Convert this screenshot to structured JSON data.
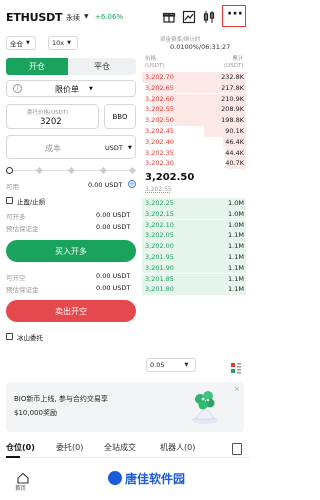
{
  "header": {
    "symbol": "ETHUSDT",
    "contract_type": "永续",
    "change": "+6.06%",
    "icons": [
      "gift-icon",
      "chart-icon",
      "candlestick-icon",
      "more-icon"
    ]
  },
  "controls": {
    "margin_mode": "全仓",
    "leverage": "10x"
  },
  "funding": {
    "label": "资金费率/倒计时",
    "value": "0.0100%/06:31:27"
  },
  "trade_tabs": {
    "open": "开仓",
    "close": "平仓"
  },
  "order_type": "限价单",
  "price_input": {
    "label": "委托价格(USDT)",
    "value": "3202",
    "bbo": "BBO"
  },
  "cost_input": {
    "placeholder": "成本",
    "unit": "USDT"
  },
  "available": {
    "label": "可用",
    "value": "0.00 USDT"
  },
  "tpsl_label": "止盈/止损",
  "long": {
    "can_open_label": "可开多",
    "can_open_value": "0.00 USDT",
    "margin_label": "预估保证金",
    "margin_value": "0.00 USDT",
    "button": "买入开多"
  },
  "short": {
    "can_open_label": "可开空",
    "can_open_value": "0.00 USDT",
    "margin_label": "预估保证金",
    "margin_value": "0.00 USDT",
    "button": "卖出开空"
  },
  "iceberg_label": "冰山委托",
  "orderbook": {
    "price_header": "价格\n(USDT)",
    "qty_header": "累计\n(USDT)",
    "asks": [
      {
        "p": "3,202.70",
        "q": "232.8K",
        "fill": 1.0
      },
      {
        "p": "3,202.65",
        "q": "217.8K",
        "fill": 0.94
      },
      {
        "p": "3,202.60",
        "q": "210.9K",
        "fill": 0.9
      },
      {
        "p": "3,202.55",
        "q": "208.9K",
        "fill": 0.89
      },
      {
        "p": "3,202.50",
        "q": "198.8K",
        "fill": 0.85
      },
      {
        "p": "3,202.45",
        "q": "90.1K",
        "fill": 0.4
      },
      {
        "p": "3,202.40",
        "q": "46.4K",
        "fill": 0.22
      },
      {
        "p": "3,202.35",
        "q": "44.4K",
        "fill": 0.2
      },
      {
        "p": "3,202.30",
        "q": "40.7K",
        "fill": 0.18
      }
    ],
    "last_price": "3,202.50",
    "mark_price": "3,202.55",
    "bids": [
      {
        "p": "3,202.25",
        "q": "1.0M",
        "fill": 1.0
      },
      {
        "p": "3,202.15",
        "q": "1.0M",
        "fill": 1.0
      },
      {
        "p": "3,202.10",
        "q": "1.0M",
        "fill": 1.0
      },
      {
        "p": "3,202.05",
        "q": "1.1M",
        "fill": 1.0
      },
      {
        "p": "3,202.00",
        "q": "1.1M",
        "fill": 1.0
      },
      {
        "p": "3,201.95",
        "q": "1.1M",
        "fill": 1.0
      },
      {
        "p": "3,201.90",
        "q": "1.1M",
        "fill": 1.0
      },
      {
        "p": "3,201.85",
        "q": "1.1M",
        "fill": 1.0
      },
      {
        "p": "3,201.80",
        "q": "1.1M",
        "fill": 1.0
      }
    ],
    "depth": "0.05"
  },
  "banner": {
    "line1": "BIO新币上线, 参与合约交易享",
    "line2": "$10,000奖励"
  },
  "bottom_tabs": [
    "仓位(0)",
    "委托(0)",
    "全站成交",
    "机器人(0)"
  ],
  "footer": {
    "home": "首页",
    "watermark": "唐佳软件园"
  },
  "colors": {
    "green": "#1aa35c",
    "red": "#e53935",
    "highlight_box": "#e53935"
  }
}
